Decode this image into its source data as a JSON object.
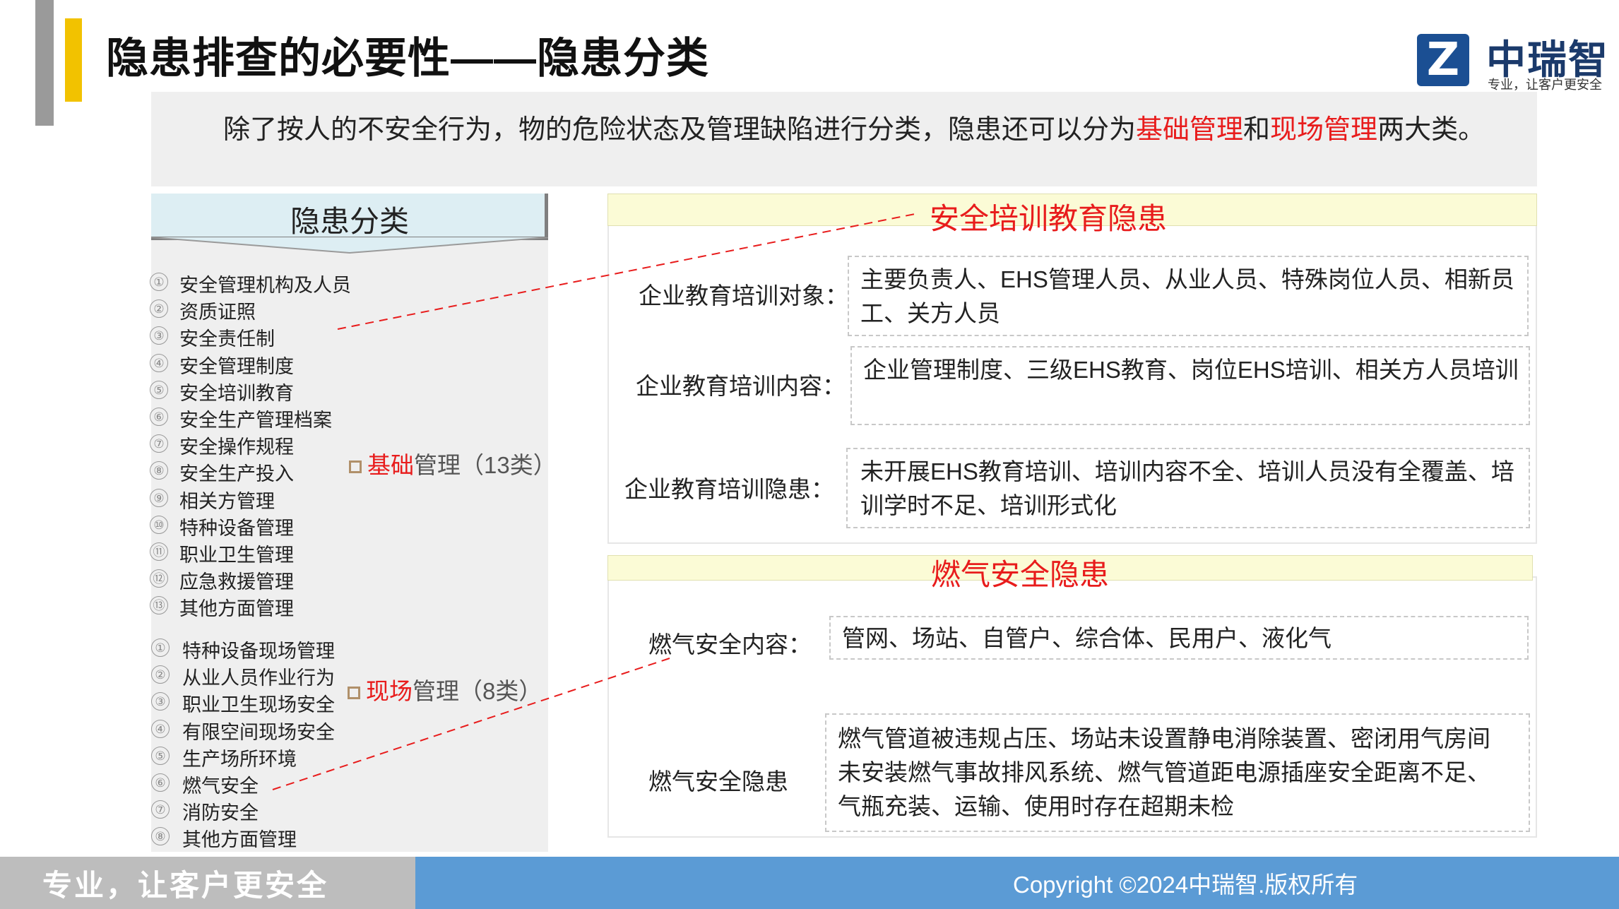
{
  "header": {
    "title": "隐患排查的必要性——隐患分类",
    "logo_letter": "Z",
    "logo_name": "中瑞智",
    "logo_slogan": "专业，让客户更安全"
  },
  "intro": {
    "part1": "除了按人的不安全行为，物的危险状态及管理缺陷进行分类，隐患还可以分为",
    "red1": "基础管理",
    "part2": "和",
    "red2": "现场管理",
    "part3": "两大类。"
  },
  "classification": {
    "title": "隐患分类",
    "basic_items": [
      {
        "num": "①",
        "label": "安全管理机构及人员"
      },
      {
        "num": "②",
        "label": "资质证照"
      },
      {
        "num": "③",
        "label": "安全责任制"
      },
      {
        "num": "④",
        "label": "安全管理制度"
      },
      {
        "num": "⑤",
        "label": "安全培训教育"
      },
      {
        "num": "⑥",
        "label": "安全生产管理档案"
      },
      {
        "num": "⑦",
        "label": "安全操作规程"
      },
      {
        "num": "⑧",
        "label": "安全生产投入"
      },
      {
        "num": "⑨",
        "label": "相关方管理"
      },
      {
        "num": "⑩",
        "label": "特种设备管理"
      },
      {
        "num": "⑪",
        "label": "职业卫生管理"
      },
      {
        "num": "⑫",
        "label": "应急救援管理"
      },
      {
        "num": "⑬",
        "label": "其他方面管理"
      }
    ],
    "basic_group": {
      "red": "基础",
      "rest": "管理（13类）"
    },
    "site_items": [
      {
        "num": "①",
        "label": "特种设备现场管理"
      },
      {
        "num": "②",
        "label": "从业人员作业行为"
      },
      {
        "num": "③",
        "label": "职业卫生现场安全"
      },
      {
        "num": "④",
        "label": "有限空间现场安全"
      },
      {
        "num": "⑤",
        "label": "生产场所环境"
      },
      {
        "num": "⑥",
        "label": "燃气安全"
      },
      {
        "num": "⑦",
        "label": "消防安全"
      },
      {
        "num": "⑧",
        "label": "其他方面管理"
      }
    ],
    "site_group": {
      "red": "现场",
      "rest": "管理（8类）"
    }
  },
  "training_panel": {
    "title": "安全培训教育隐患",
    "rows": [
      {
        "label": "企业教育培训对象：",
        "text": "主要负责人、EHS管理人员、从业人员、特殊岗位人员、相新员工、关方人员"
      },
      {
        "label": "企业教育培训内容：",
        "text": "企业管理制度、三级EHS教育、岗位EHS培训、相关方人员培训"
      },
      {
        "label": "企业教育培训隐患：",
        "text": "未开展EHS教育培训、培训内容不全、培训人员没有全覆盖、培训学时不足、培训形式化"
      }
    ]
  },
  "gas_panel": {
    "title": "燃气安全隐患",
    "rows": [
      {
        "label": "燃气安全内容：",
        "text": "管网、场站、自管户、综合体、民用户、液化气"
      },
      {
        "label": "燃气安全隐患",
        "text": "燃气管道被违规占压、场站未设置静电消除装置、密闭用气房间未安装燃气事故排风系统、燃气管道距电源插座安全距离不足、气瓶充装、运输、使用时存在超期未检"
      }
    ]
  },
  "footer": {
    "slogan": "专业，让客户更安全",
    "copyright": "Copyright ©2024中瑞智.版权所有"
  },
  "colors": {
    "accent_red": "#e81c1c",
    "footer_blue": "#5b9bd5",
    "title_bar": "#f2c200",
    "logo_blue": "#1b4f93"
  }
}
